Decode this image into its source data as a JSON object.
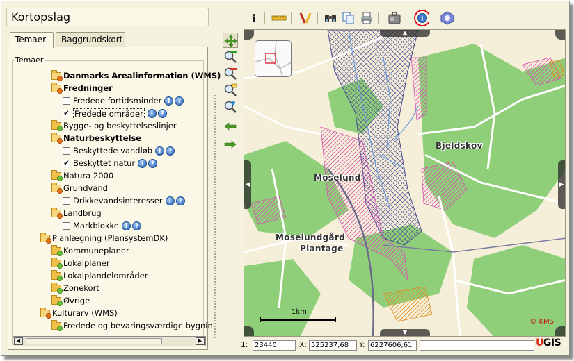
{
  "app": {
    "title": "Kortopslag"
  },
  "tabs": [
    {
      "label": "Temaer"
    },
    {
      "label": "Baggrundskort"
    }
  ],
  "panel": {
    "legend": "Temaer"
  },
  "tree": [
    {
      "label": "Danmarks Arealinformation (WMS)",
      "type": "folder-open",
      "bold": true
    },
    {
      "label": "Fredninger",
      "type": "folder-open",
      "bold": true
    },
    {
      "label": "Fredede fortidsminder",
      "type": "check",
      "checked": false,
      "info": true
    },
    {
      "label": "Fredede områder",
      "type": "check",
      "checked": true,
      "info": true,
      "focused": true
    },
    {
      "label": "Bygge- og beskyttelseslinjer",
      "type": "folder-leaf"
    },
    {
      "label": "Naturbeskyttelse",
      "type": "folder-open",
      "bold": true
    },
    {
      "label": "Beskyttede vandløb",
      "type": "check",
      "checked": false,
      "info": true
    },
    {
      "label": "Beskyttet natur",
      "type": "check",
      "checked": true,
      "info": true
    },
    {
      "label": "Natura 2000",
      "type": "folder-leaf"
    },
    {
      "label": "Grundvand",
      "type": "folder-open"
    },
    {
      "label": "Drikkevandsinteresser",
      "type": "check",
      "checked": false,
      "info": true
    },
    {
      "label": "Landbrug",
      "type": "folder-open"
    },
    {
      "label": "Markblokke",
      "type": "check",
      "checked": false,
      "info": true
    },
    {
      "label": "Planlægning (PlansystemDK)",
      "type": "folder-open"
    },
    {
      "label": "Kommuneplaner",
      "type": "folder-leaf"
    },
    {
      "label": "Lokalplaner",
      "type": "folder-leaf"
    },
    {
      "label": "Lokalplandelområder",
      "type": "folder-leaf"
    },
    {
      "label": "Zonekort",
      "type": "folder-leaf"
    },
    {
      "label": "Øvrige",
      "type": "folder-leaf"
    },
    {
      "label": "Kulturarv (WMS)",
      "type": "folder-open"
    },
    {
      "label": "Fredede og bevaringsværdige bygnin",
      "type": "folder-leaf"
    }
  ],
  "toolbar": {
    "buttons": [
      {
        "icon": "info-i-icon"
      },
      {
        "icon": "ruler-icon"
      },
      {
        "icon": "draw-icon"
      },
      {
        "icon": "binoculars-icon"
      },
      {
        "icon": "copy-icon"
      },
      {
        "icon": "print-icon"
      },
      {
        "icon": "bag-icon"
      },
      {
        "icon": "feature-info-icon",
        "highlighted": true
      },
      {
        "icon": "globe-icon"
      }
    ],
    "highlight_color": "#e0001a"
  },
  "map": {
    "places": [
      "Bjeldskov",
      "Moselund",
      "Moselundgård",
      "Plantage"
    ],
    "scale_label": "1km",
    "copyright": "© KMS"
  },
  "status": {
    "scale_prefix": "1:",
    "scale": "23440",
    "x_label": "X:",
    "x": "525237,68",
    "y_label": "Y:",
    "y": "6227606,61",
    "extra": ""
  },
  "logo": {
    "u": "U",
    "rest": "GIS"
  }
}
